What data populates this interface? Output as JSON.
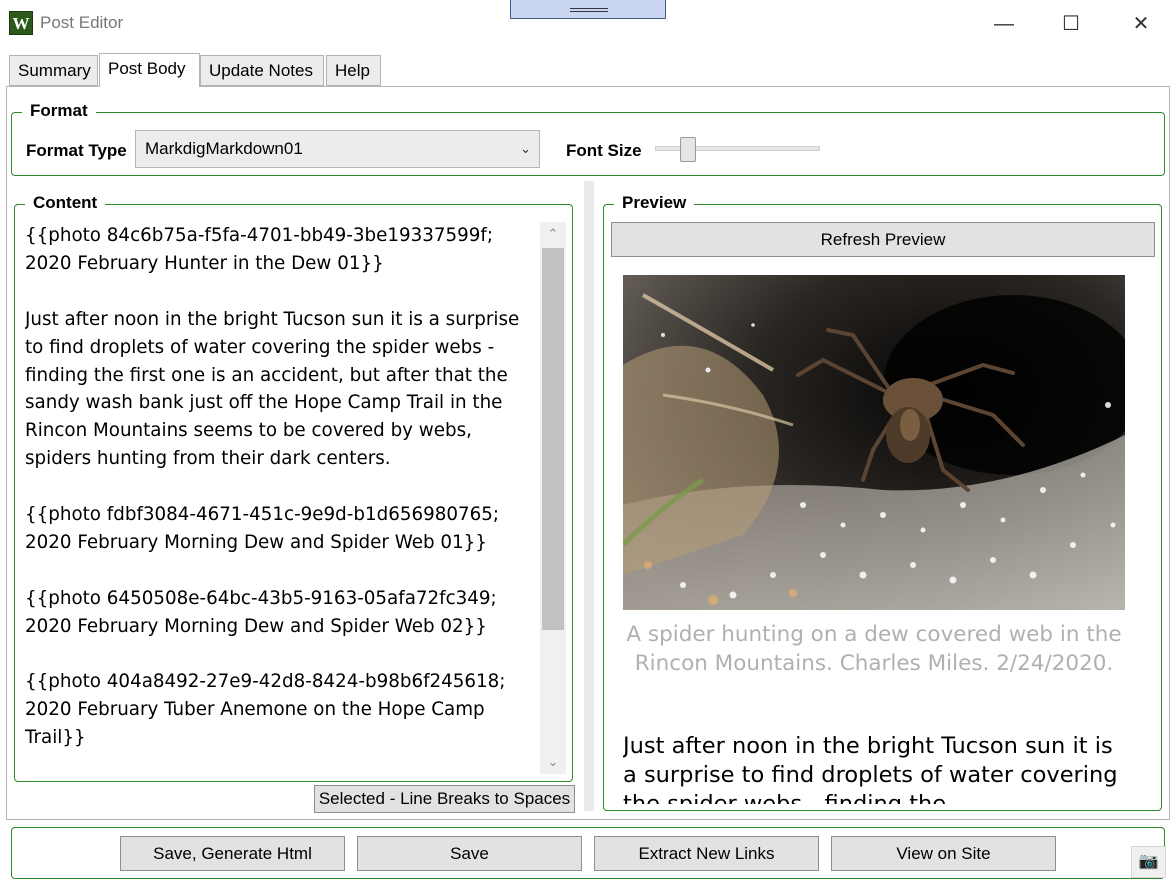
{
  "window": {
    "title": "Post Editor",
    "app_icon_letter": "W",
    "minimize_glyph": "—",
    "maximize_glyph": "☐",
    "close_glyph": "✕"
  },
  "tabs": [
    {
      "label": "Summary",
      "active": false
    },
    {
      "label": "Post Body",
      "active": true
    },
    {
      "label": "Update Notes",
      "active": false
    },
    {
      "label": "Help",
      "active": false
    }
  ],
  "format": {
    "group_label": "Format",
    "type_label": "Format Type",
    "type_value": "MarkdigMarkdown01",
    "font_size_label": "Font Size",
    "font_size_level": 0.17
  },
  "content": {
    "group_label": "Content",
    "paragraphs": [
      "{{photo 84c6b75a-f5fa-4701-bb49-3be19337599f; 2020 February Hunter in the Dew 01}}",
      "Just after noon in the bright Tucson sun it is a surprise to find droplets of water covering the spider webs - finding the first one is an accident, but after that the sandy wash bank just off the Hope Camp Trail in the Rincon Mountains seems to be covered by webs, spiders hunting from their dark centers.",
      "{{photo fdbf3084-4671-451c-9e9d-b1d656980765; 2020 February Morning Dew and Spider Web 01}}",
      "{{photo 6450508e-64bc-43b5-9163-05afa72fc349; 2020 February Morning Dew and Spider Web 02}}",
      "{{photo 404a8492-27e9-42d8-8424-b98b6f245618; 2020 February Tuber Anemone on the Hope Camp Trail}}"
    ],
    "line_breaks_button": "Selected - Line Breaks to Spaces"
  },
  "preview": {
    "group_label": "Preview",
    "refresh_button": "Refresh Preview",
    "caption": "A spider hunting on a dew covered web in the Rincon Mountains. Charles Miles. 2/24/2020.",
    "body_text": "Just after noon in the bright Tucson sun it is a surprise to find droplets of water covering the spider webs - finding the"
  },
  "actions": {
    "save_generate": "Save, Generate Html",
    "save": "Save",
    "extract_links": "Extract New Links",
    "view_on_site": "View on Site"
  },
  "colors": {
    "group_border": "#2b8a2b",
    "app_icon": "#2d5a1b",
    "caption_text": "#b0b0b0"
  },
  "icons": {
    "scroll_up": "⌃",
    "scroll_down": "⌄",
    "combo_arrow": "⌄",
    "camera": "📷"
  }
}
